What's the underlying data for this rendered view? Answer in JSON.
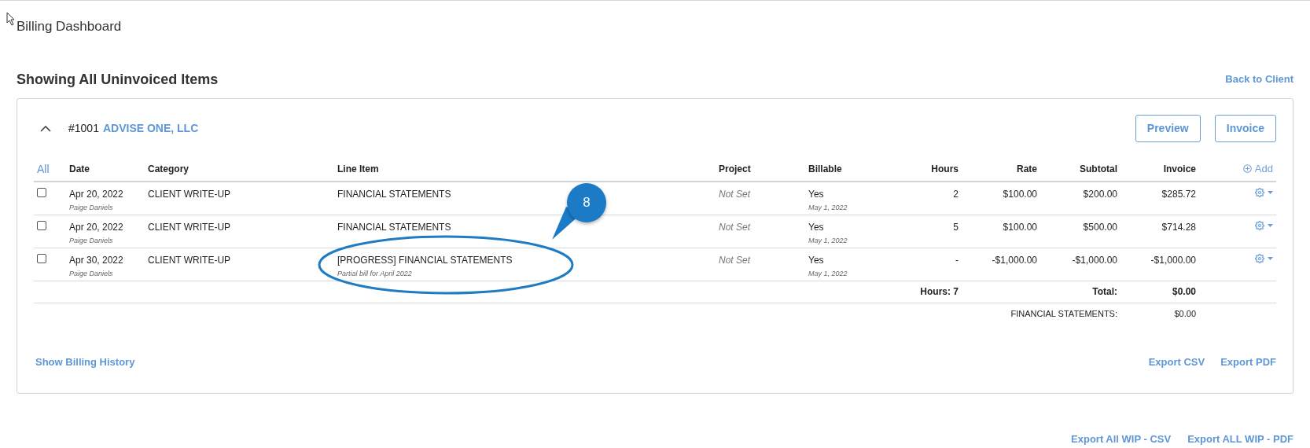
{
  "page_title": "Billing Dashboard",
  "heading": "Showing All Uninvoiced Items",
  "back_link": "Back to Client",
  "group": {
    "number": "#1001",
    "client": "ADVISE ONE, LLC",
    "expanded": true,
    "buttons": [
      "Preview",
      "Invoice"
    ]
  },
  "table": {
    "select_all": "All",
    "columns": [
      "Date",
      "Category",
      "Line Item",
      "Project",
      "Billable",
      "Hours",
      "Rate",
      "Subtotal",
      "Invoice"
    ],
    "add_label": "Add",
    "rows": [
      {
        "checked": false,
        "date": "Apr 20, 2022",
        "user": "Paige Daniels",
        "category": "CLIENT WRITE-UP",
        "line_item": "FINANCIAL STATEMENTS",
        "project": "Not Set",
        "billable": "Yes",
        "billable_date": "May 1, 2022",
        "hours": "2",
        "rate": "$100.00",
        "subtotal": "$200.00",
        "invoice": "$285.72"
      },
      {
        "checked": false,
        "date": "Apr 20, 2022",
        "user": "Paige Daniels",
        "category": "CLIENT WRITE-UP",
        "line_item": "FINANCIAL STATEMENTS",
        "project": "Not Set",
        "billable": "Yes",
        "billable_date": "May 1, 2022",
        "hours": "5",
        "rate": "$100.00",
        "subtotal": "$500.00",
        "invoice": "$714.28"
      },
      {
        "checked": false,
        "date": "Apr 30, 2022",
        "user": "Paige Daniels",
        "category": "CLIENT WRITE-UP",
        "line_item": "[PROGRESS] FINANCIAL STATEMENTS",
        "note": "Partial bill for April 2022",
        "project": "Not Set",
        "billable": "Yes",
        "billable_date": "May 1, 2022",
        "hours": "-",
        "rate": "-$1,000.00",
        "subtotal": "-$1,000.00",
        "invoice": "-$1,000.00"
      }
    ],
    "hours_total": "Hours: 7",
    "total_label": "Total:",
    "total_value": "$0.00",
    "summary_label": "FINANCIAL STATEMENTS:",
    "summary_value": "$0.00"
  },
  "card_links_left": [
    "Show Billing History"
  ],
  "card_links_right": [
    "Export CSV",
    "Export PDF"
  ],
  "page_links": [
    "Export All WIP - CSV",
    "Export ALL WIP - PDF"
  ],
  "annotation": {
    "label": "8"
  }
}
